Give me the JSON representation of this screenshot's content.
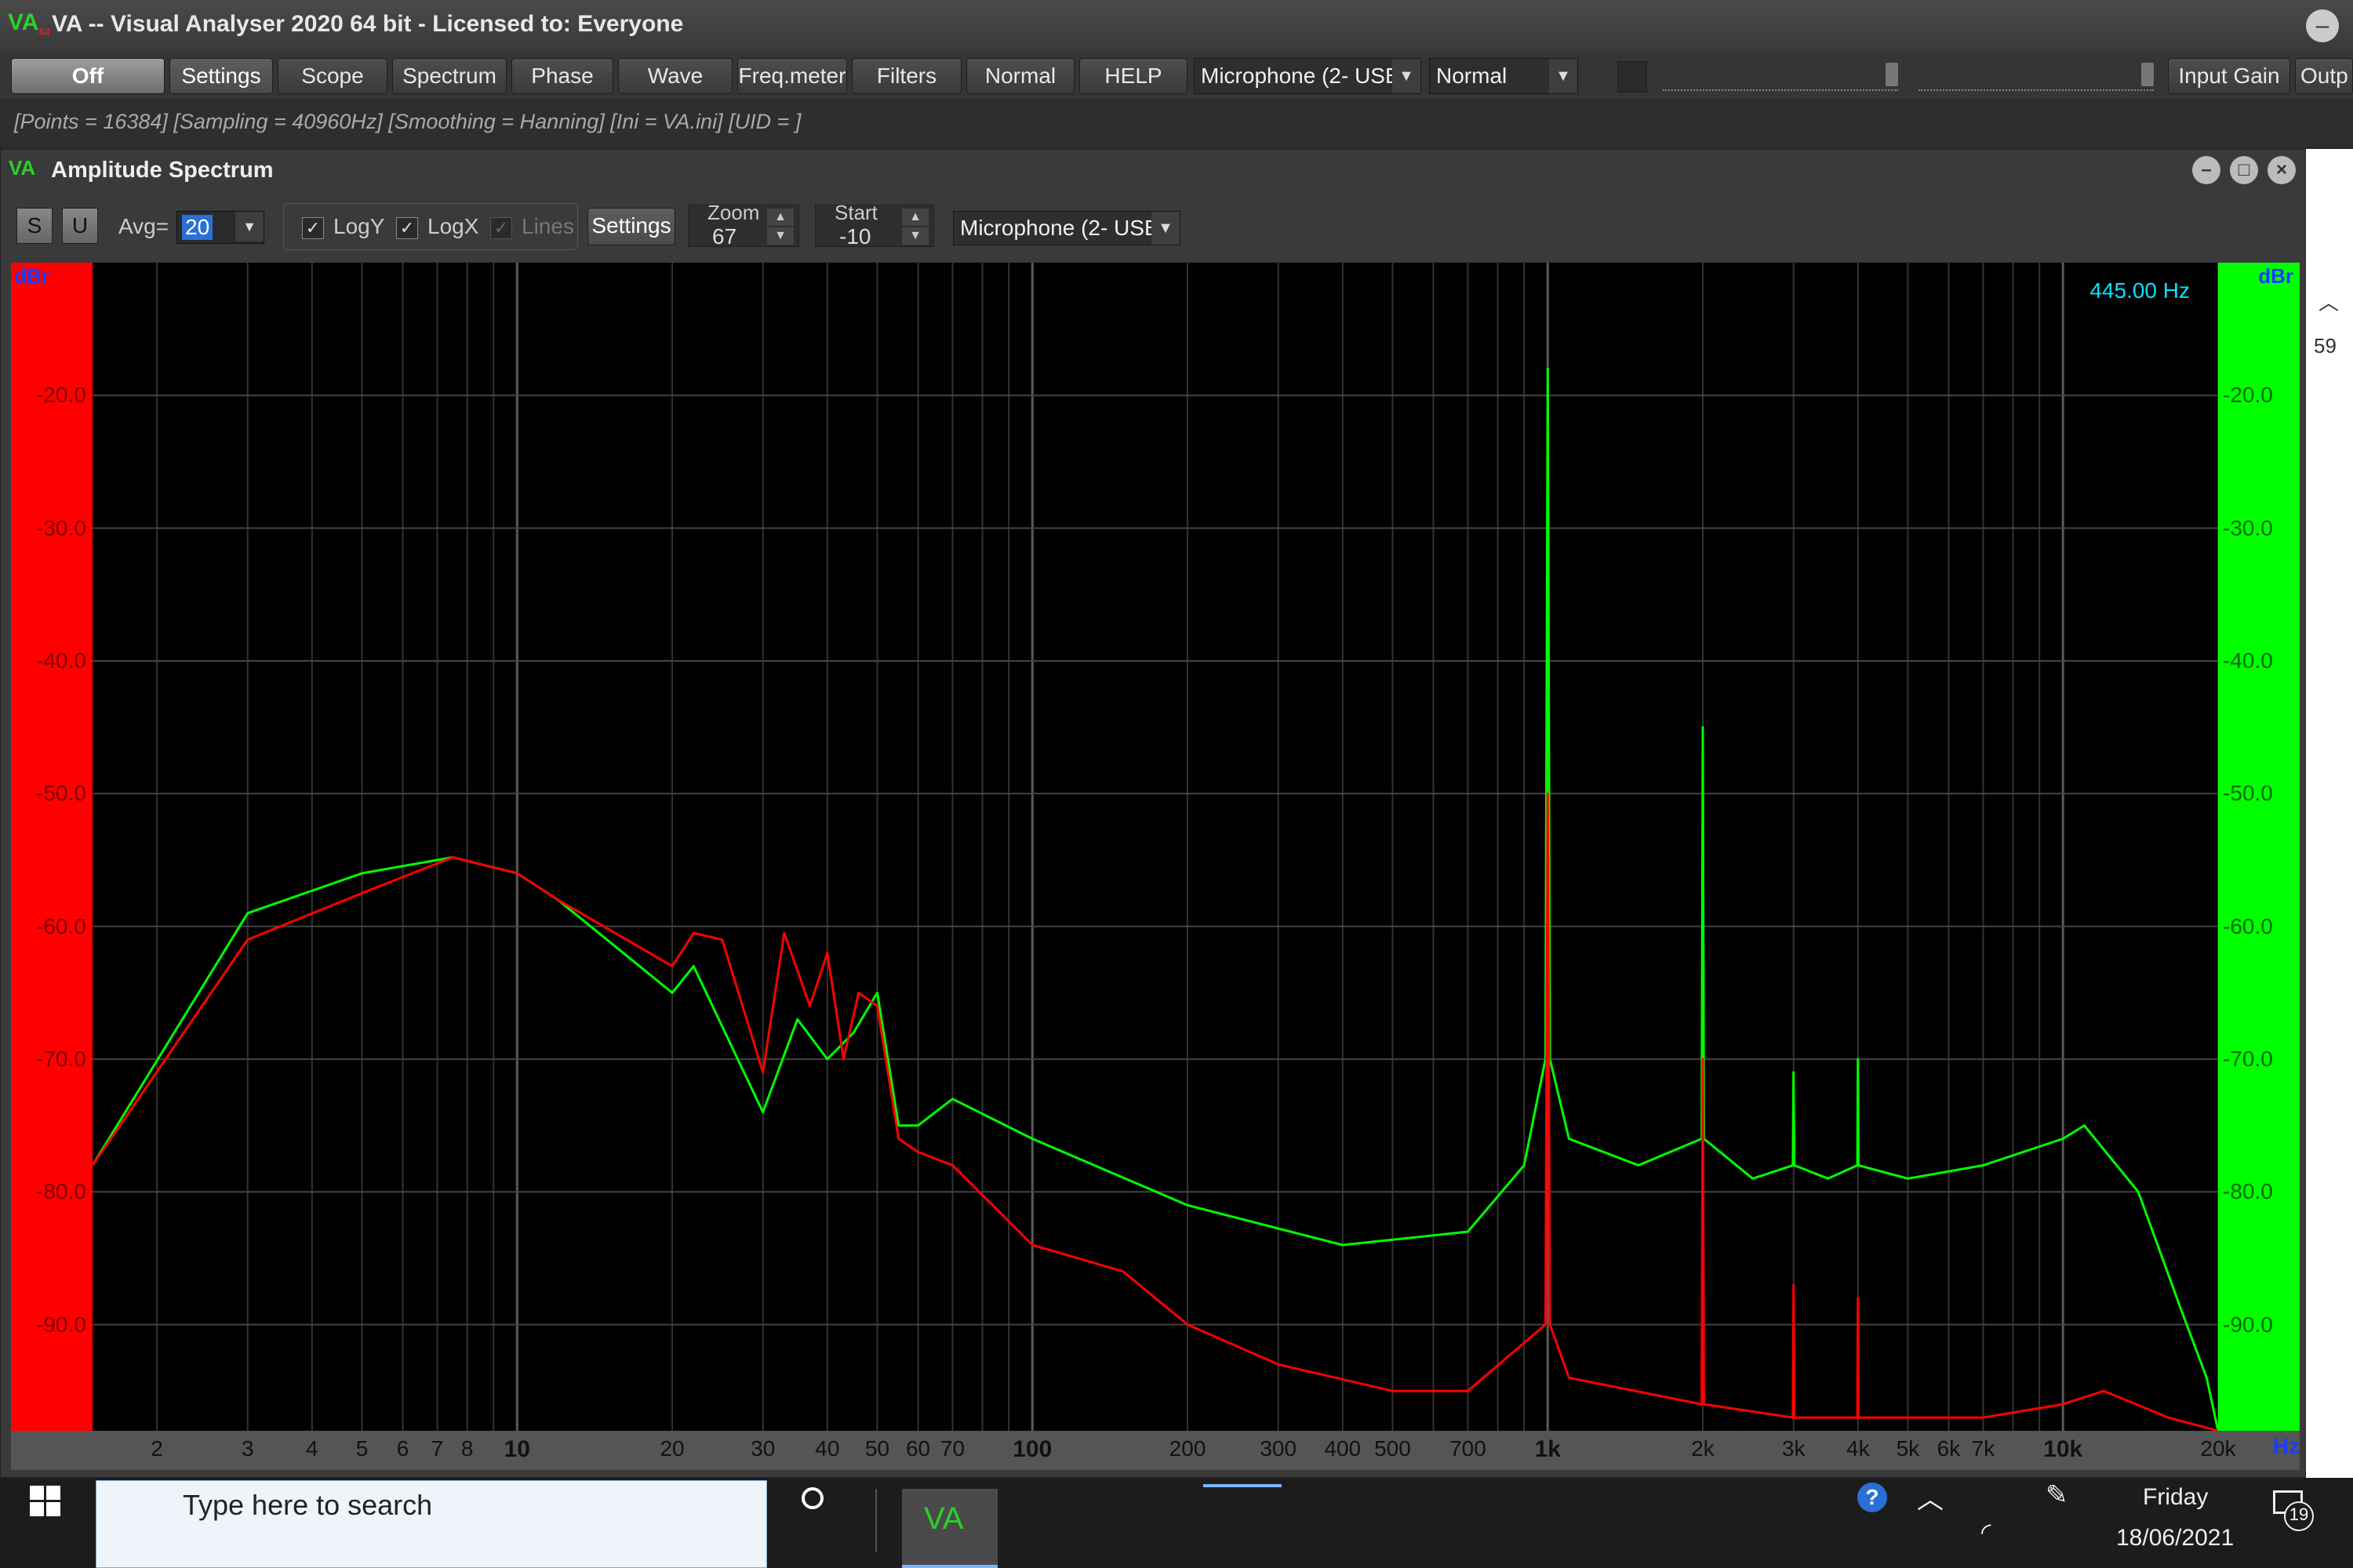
{
  "window": {
    "title": "VA -- Visual Analyser 2020 64 bit - Licensed to: Everyone",
    "logo": "VA"
  },
  "toolbar": {
    "buttons": [
      "Off",
      "Settings",
      "Scope",
      "Spectrum",
      "Phase",
      "Wave",
      "Freq.meter",
      "Filters",
      "Normal",
      "HELP"
    ],
    "input_device": "Microphone (2- USB",
    "mode": "Normal",
    "input_gain_label": "Input Gain",
    "output_label": "Outp"
  },
  "status": "[Points = 16384]  [Sampling = 40960Hz]  [Smoothing = Hanning]  [Ini = VA.ini]  [UID = ]",
  "spectrum_window": {
    "title": "Amplitude Spectrum",
    "s_label": "S",
    "u_label": "U",
    "avg_label": "Avg=",
    "avg_value": "20",
    "logy_label": "LogY",
    "logx_label": "LogX",
    "lines_label": "Lines",
    "settings_label": "Settings",
    "zoom_label": "Zoom",
    "zoom_value": "67",
    "start_label": "Start",
    "start_value": "-10",
    "device": "Microphone (2- USB",
    "cursor_readout": "445.00 Hz",
    "left_unit": "dBr",
    "right_unit": "dBr",
    "x_unit": "Hz",
    "side_value": "59",
    "colors": {
      "left_channel": "#ff0000",
      "right_channel": "#00ff00",
      "plot_bg": "#000000",
      "readout": "#00e5ff"
    }
  },
  "chart_data": {
    "type": "line",
    "xscale": "log",
    "xlim": [
      1.5,
      20000
    ],
    "ylim": [
      -98,
      -10
    ],
    "y_ticks": [
      "-20.0",
      "-30.0",
      "-40.0",
      "-50.0",
      "-60.0",
      "-70.0",
      "-80.0",
      "-90.0"
    ],
    "y_tick_values": [
      -20,
      -30,
      -40,
      -50,
      -60,
      -70,
      -80,
      -90
    ],
    "x_ticks": [
      "2",
      "3",
      "4",
      "5",
      "6",
      "7",
      "8",
      "10",
      "20",
      "30",
      "40",
      "50",
      "60",
      "70",
      "100",
      "200",
      "300",
      "400",
      "500",
      "700",
      "1k",
      "2k",
      "3k",
      "4k",
      "5k",
      "6k",
      "7k",
      "10k",
      "20k"
    ],
    "x_tick_values": [
      2,
      3,
      4,
      5,
      6,
      7,
      8,
      10,
      20,
      30,
      40,
      50,
      60,
      70,
      100,
      200,
      300,
      400,
      500,
      700,
      1000,
      2000,
      3000,
      4000,
      5000,
      6000,
      7000,
      10000,
      20000
    ],
    "series": [
      {
        "color": "#00ff00",
        "x": [
          1.5,
          3,
          5,
          7.5,
          10,
          12,
          20,
          22,
          30,
          35,
          40,
          45,
          50,
          55,
          60,
          70,
          100,
          200,
          400,
          700,
          900,
          990,
          1000,
          1010,
          1100,
          1500,
          1990,
          2000,
          2010,
          2500,
          2990,
          3000,
          3010,
          3500,
          3990,
          4000,
          4010,
          5000,
          7000,
          10000,
          11000,
          14000,
          17000,
          19000,
          20000
        ],
        "y": [
          -78,
          -59,
          -56,
          -54.8,
          -56,
          -58,
          -65,
          -63,
          -74,
          -67,
          -70,
          -68,
          -65,
          -75,
          -75,
          -73,
          -76,
          -81,
          -84,
          -83,
          -78,
          -70,
          -18,
          -70,
          -76,
          -78,
          -76,
          -45,
          -76,
          -79,
          -78,
          -71,
          -78,
          -79,
          -78,
          -70,
          -78,
          -79,
          -78,
          -76,
          -75,
          -80,
          -89,
          -94,
          -98
        ]
      },
      {
        "color": "#ff0000",
        "x": [
          1.5,
          3,
          5,
          7.5,
          10,
          12,
          20,
          22,
          25,
          30,
          33,
          37,
          40,
          43,
          46,
          50,
          55,
          60,
          70,
          100,
          150,
          200,
          300,
          500,
          700,
          990,
          1000,
          1010,
          1100,
          1990,
          2000,
          2010,
          2990,
          3000,
          3010,
          3990,
          4000,
          4010,
          7000,
          10000,
          12000,
          16000,
          20000
        ],
        "y": [
          -78,
          -61,
          -57.5,
          -54.8,
          -56,
          -58,
          -63,
          -60.5,
          -61,
          -71,
          -60.5,
          -66,
          -62,
          -70,
          -65,
          -66,
          -76,
          -77,
          -78,
          -84,
          -86,
          -90,
          -93,
          -95,
          -95,
          -90,
          -50,
          -90,
          -94,
          -96,
          -70,
          -96,
          -97,
          -87,
          -97,
          -97,
          -88,
          -97,
          -97,
          -96,
          -95,
          -97,
          -98
        ]
      }
    ]
  },
  "taskbar": {
    "search_placeholder": "Type here to search",
    "app": "VA",
    "day": "Friday",
    "date": "18/06/2021",
    "notifications": "19"
  }
}
